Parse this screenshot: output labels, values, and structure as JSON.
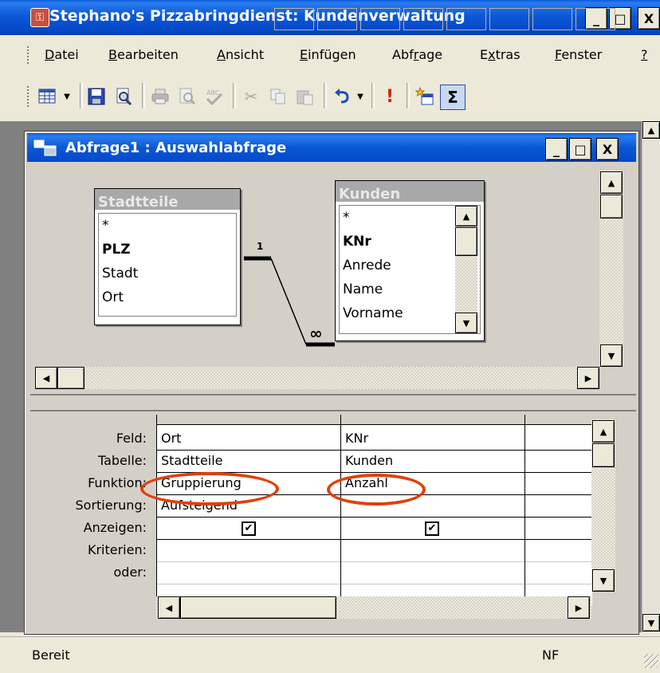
{
  "app": {
    "title": "Stephano's Pizzabringdienst: Kundenverwaltung",
    "caption_buttons": {
      "minimize": "_",
      "restore": "□",
      "close": "X"
    }
  },
  "menu": {
    "items": [
      {
        "pre": "",
        "u": "D",
        "post": "atei"
      },
      {
        "pre": "",
        "u": "B",
        "post": "earbeiten"
      },
      {
        "pre": "",
        "u": "A",
        "post": "nsicht"
      },
      {
        "pre": "",
        "u": "E",
        "post": "infügen"
      },
      {
        "pre": "Abf",
        "u": "r",
        "post": "age"
      },
      {
        "pre": "E",
        "u": "x",
        "post": "tras"
      },
      {
        "pre": "",
        "u": "F",
        "post": "enster"
      },
      {
        "pre": "",
        "u": "?",
        "post": ""
      }
    ]
  },
  "toolbar": {
    "sigma": "Σ"
  },
  "query_window": {
    "title": "Abfrage1 : Auswahlabfrage",
    "caption_buttons": {
      "minimize": "_",
      "restore": "□",
      "close": "X"
    }
  },
  "tables": {
    "stadtteile": {
      "name": "Stadtteile",
      "fields": [
        "*",
        "PLZ",
        "Stadt",
        "Ort"
      ]
    },
    "kunden": {
      "name": "Kunden",
      "fields": [
        "*",
        "KNr",
        "Anrede",
        "Name",
        "Vorname"
      ]
    },
    "relation": {
      "one": "1",
      "many": "∞"
    }
  },
  "grid": {
    "row_labels": [
      "Feld:",
      "Tabelle:",
      "Funktion:",
      "Sortierung:",
      "Anzeigen:",
      "Kriterien:",
      "oder:"
    ],
    "columns": [
      {
        "feld": "Ort",
        "tabelle": "Stadtteile",
        "funktion": "Gruppierung",
        "sortierung": "Aufsteigend",
        "anzeigen": "✔"
      },
      {
        "feld": "KNr",
        "tabelle": "Kunden",
        "funktion": "Anzahl",
        "sortierung": "",
        "anzeigen": "✔"
      }
    ]
  },
  "status": {
    "text": "Bereit",
    "indicator": "NF"
  },
  "colors": {
    "titlebar": "#0b58d6",
    "annotation_ellipse": "#e0400c"
  }
}
